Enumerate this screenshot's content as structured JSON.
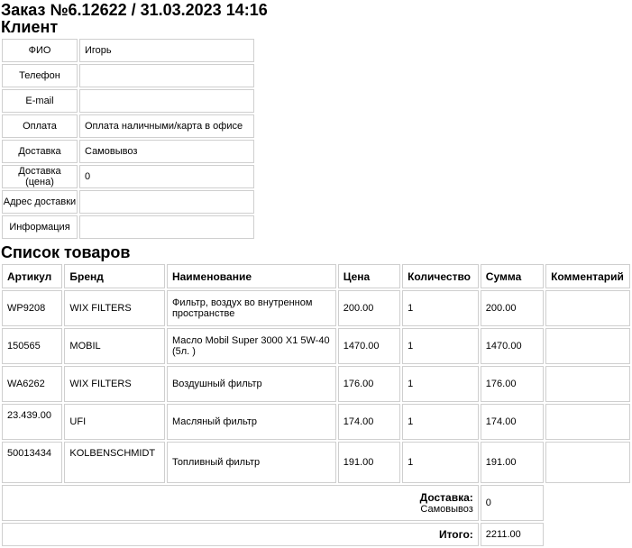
{
  "order": {
    "title": "Заказ №6.12622 / 31.03.2023 14:16"
  },
  "client": {
    "heading": "Клиент",
    "rows": [
      {
        "label": "ФИО",
        "value": "Игорь"
      },
      {
        "label": "Телефон",
        "value": ""
      },
      {
        "label": "E-mail",
        "value": ""
      },
      {
        "label": "Оплата",
        "value": "Оплата наличными/карта в офисе"
      },
      {
        "label": "Доставка",
        "value": "Самовывоз"
      },
      {
        "label": "Доставка (цена)",
        "value": "0"
      },
      {
        "label": "Адрес доставки",
        "value": ""
      },
      {
        "label": "Информация",
        "value": ""
      }
    ]
  },
  "products": {
    "heading": "Список товаров",
    "columns": [
      "Артикул",
      "Бренд",
      "Наименование",
      "Цена",
      "Количество",
      "Сумма",
      "Комментарий"
    ],
    "rows": [
      {
        "article": "WP9208",
        "brand": "WIX FILTERS",
        "name": "Фильтр, воздух во внутренном пространстве",
        "price": "200.00",
        "qty": "1",
        "sum": "200.00",
        "comment": ""
      },
      {
        "article": "150565",
        "brand": "MOBIL",
        "name": "Масло Mobil Super 3000 X1 5W-40 (5л. )",
        "price": "1470.00",
        "qty": "1",
        "sum": "1470.00",
        "comment": ""
      },
      {
        "article": "WA6262",
        "brand": "WIX FILTERS",
        "name": "Воздушный фильтр",
        "price": "176.00",
        "qty": "1",
        "sum": "176.00",
        "comment": ""
      },
      {
        "article": "23.439.00",
        "brand": "UFI",
        "name": "Масляный фильтр",
        "price": "174.00",
        "qty": "1",
        "sum": "174.00",
        "comment": ""
      },
      {
        "article": "50013434",
        "brand": "KOLBENSCHMIDT",
        "name": "Топливный фильтр",
        "price": "191.00",
        "qty": "1",
        "sum": "191.00",
        "comment": ""
      }
    ],
    "delivery": {
      "label": "Доставка:",
      "method": "Самовывоз",
      "value": "0"
    },
    "total": {
      "label": "Итого:",
      "value": "2211.00"
    }
  }
}
